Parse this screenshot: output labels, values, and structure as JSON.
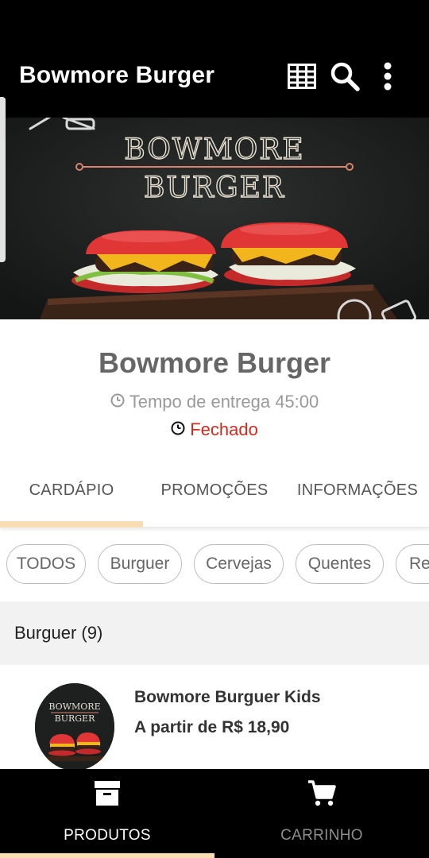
{
  "app_bar": {
    "title": "Bowmore Burger",
    "icons": [
      "grid-view-icon",
      "search-icon",
      "more-vert-icon"
    ]
  },
  "hero": {
    "line1": "BOWMORE",
    "line2": "BURGER"
  },
  "restaurant": {
    "name": "Bowmore Burger",
    "delivery_time": "Tempo de entrega 45:00",
    "status": "Fechado"
  },
  "tabs": [
    {
      "label": "CARDÁPIO",
      "active": true
    },
    {
      "label": "PROMOÇÕES",
      "active": false
    },
    {
      "label": "INFORMAÇÕES",
      "active": false
    }
  ],
  "categories": [
    "TODOS",
    "Burguer",
    "Cervejas",
    "Quentes",
    "Re"
  ],
  "section": {
    "title": "Burguer (9)"
  },
  "products": [
    {
      "name": "Bowmore Burguer Kids",
      "price": "A partir de R$ 18,90",
      "thumb_line1": "BOWMORE",
      "thumb_line2": "BURGER"
    }
  ],
  "bottom_nav": [
    {
      "label": "PRODUTOS",
      "icon": "archive-icon",
      "active": true
    },
    {
      "label": "CARRINHO",
      "icon": "cart-icon",
      "active": false
    }
  ],
  "colors": {
    "bar": "#000000",
    "accent_indicator": "#f7dcb4",
    "status_closed": "#d12b1f",
    "bun": "#d93131"
  }
}
